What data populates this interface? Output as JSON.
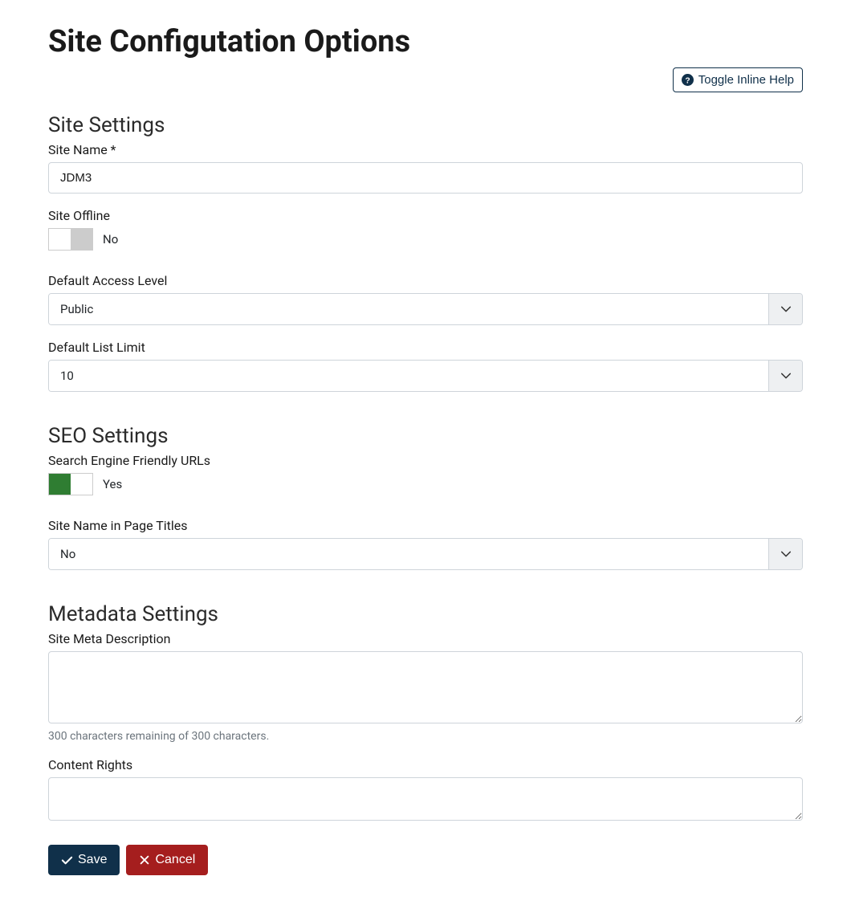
{
  "page": {
    "title": "Site Configutation Options"
  },
  "toolbar": {
    "toggle_help_label": "Toggle Inline Help"
  },
  "sections": {
    "site": {
      "heading": "Site Settings",
      "site_name": {
        "label": "Site Name *",
        "value": "JDM3"
      },
      "site_offline": {
        "label": "Site Offline",
        "state_text": "No",
        "on": false
      },
      "default_access_level": {
        "label": "Default Access Level",
        "value": "Public"
      },
      "default_list_limit": {
        "label": "Default List Limit",
        "value": "10"
      }
    },
    "seo": {
      "heading": "SEO Settings",
      "sef_urls": {
        "label": "Search Engine Friendly URLs",
        "state_text": "Yes",
        "on": true
      },
      "site_name_in_titles": {
        "label": "Site Name in Page Titles",
        "value": "No"
      }
    },
    "metadata": {
      "heading": "Metadata Settings",
      "meta_description": {
        "label": "Site Meta Description",
        "value": "",
        "helper": "300 characters remaining of 300 characters."
      },
      "content_rights": {
        "label": "Content Rights",
        "value": ""
      }
    }
  },
  "actions": {
    "save_label": "Save",
    "cancel_label": "Cancel"
  }
}
